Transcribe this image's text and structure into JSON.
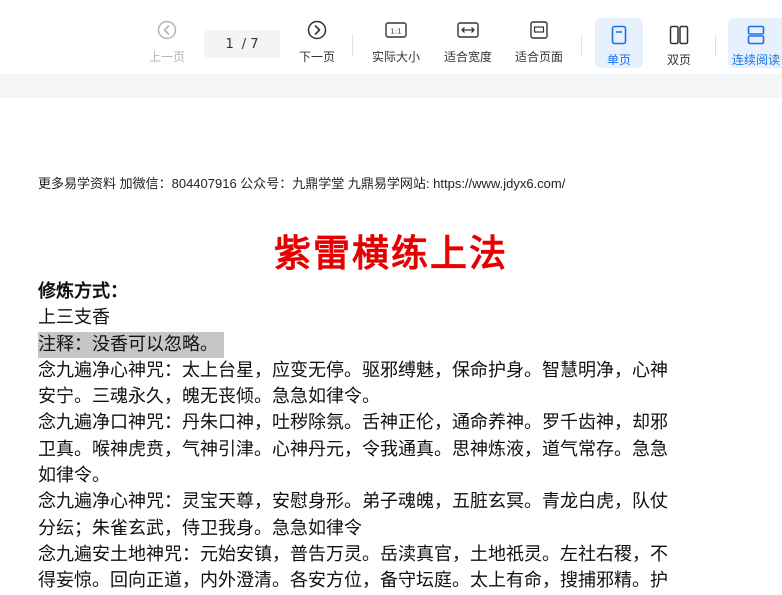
{
  "toolbar": {
    "prev_label": "上一页",
    "page_current": "1",
    "page_total": "/ 7",
    "next_label": "下一页",
    "actual_size_label": "实际大小",
    "actual_size_icon_text": "1:1",
    "fit_width_label": "适合宽度",
    "fit_page_label": "适合页面",
    "single_page_label": "单页",
    "double_page_label": "双页",
    "continuous_label": "连续阅读",
    "accent_color": "#1a73e8"
  },
  "document": {
    "header_line": "更多易学资料 加微信：804407916 公众号：九鼎学堂 九鼎易学网站: https://www.jdyx6.com/",
    "title": "紫雷横练上法",
    "title_color": "#e60000",
    "method_heading": "修炼方式：",
    "incense": "上三支香",
    "note": "注释：没香可以忽略。",
    "lines": [
      "念九遍净心神咒：太上台星，应变无停。驱邪缚魅，保命护身。智慧明净，心神",
      "安宁。三魂永久，魄无丧倾。急急如律令。",
      "念九遍净口神咒：丹朱口神，吐秽除氛。舌神正伦，通命养神。罗千齿神，却邪",
      "卫真。喉神虎贲，气神引津。心神丹元，令我通真。思神炼液，道气常存。急急",
      "如律令。",
      "念九遍净心神咒：灵宝天尊，安慰身形。弟子魂魄，五脏玄冥。青龙白虎，队仗",
      "分纭；朱雀玄武，侍卫我身。急急如律令",
      "念九遍安土地神咒：元始安镇，普告万灵。岳渎真官，土地祇灵。左社右稷，不",
      "得妄惊。回向正道，内外澄清。各安方位，备守坛庭。太上有命，搜捕邪精。护"
    ]
  }
}
